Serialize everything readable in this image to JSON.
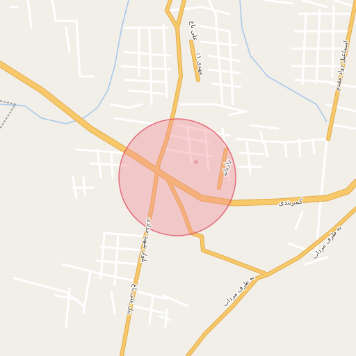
{
  "map": {
    "highway_label": "کمربندی",
    "road_labels": {
      "north_street_1": "علی باغ",
      "north_street_2": "۱۱ مهدی",
      "east_vertical_street": "اسماعیل دواد مقدم",
      "south_boulevard": "بلوار شهید حدادی",
      "south_street_ali_bagh": "پیل علی باغ",
      "southeast_road": "به طرف مرداب",
      "center_street": "رازیانه"
    },
    "colors": {
      "background": "#f2efe9",
      "minor_road": "#ffffff",
      "major_road": "#f7c96a",
      "major_road_casing": "#e3aa49",
      "water": "#a9c8ea",
      "highlight_fill": "#f28c96",
      "highlight_stroke": "#e05060"
    },
    "highlight": {
      "shape": "circle",
      "description": "selected area"
    }
  }
}
